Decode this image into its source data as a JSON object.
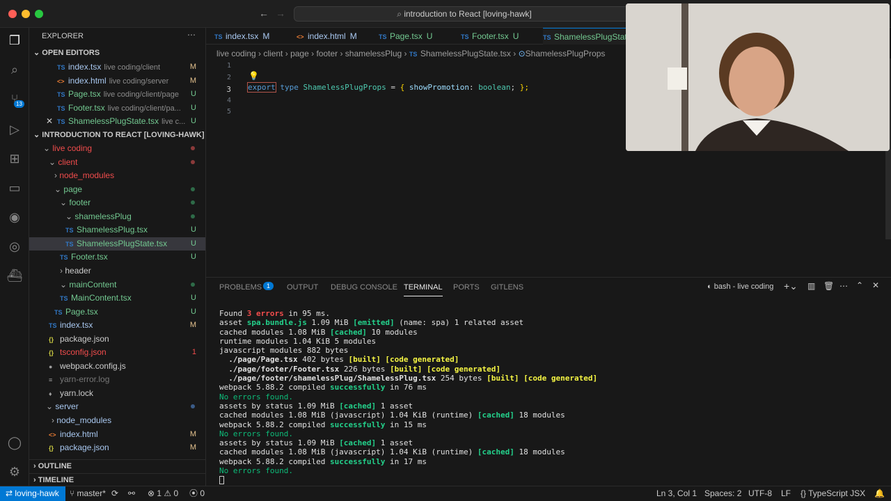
{
  "window": {
    "command_center": "introduction to React [loving-hawk]"
  },
  "sidebar": {
    "title": "EXPLORER",
    "open_editors_title": "OPEN EDITORS",
    "open_editors": [
      {
        "icon": "TS",
        "name": "index.tsx",
        "desc": "live coding/client",
        "status": "M"
      },
      {
        "icon": "<>",
        "name": "index.html",
        "desc": "live coding/server",
        "status": "M"
      },
      {
        "icon": "TS",
        "name": "Page.tsx",
        "desc": "live coding/client/page",
        "status": "U"
      },
      {
        "icon": "TS",
        "name": "Footer.tsx",
        "desc": "live coding/client/pa...",
        "status": "U"
      },
      {
        "icon": "TS",
        "name": "ShamelessPlugState.tsx",
        "desc": "live c...",
        "status": "U"
      }
    ],
    "project_title": "INTRODUCTION TO REACT [LOVING-HAWK]",
    "tree": [
      {
        "name": "live coding",
        "type": "folder-open"
      },
      {
        "name": "client",
        "type": "folder-open"
      },
      {
        "name": "node_modules",
        "type": "folder"
      },
      {
        "name": "page",
        "type": "folder-open"
      },
      {
        "name": "footer",
        "type": "folder-open"
      },
      {
        "name": "shamelessPlug",
        "type": "folder-open"
      },
      {
        "icon": "TS",
        "name": "ShamelessPlug.tsx",
        "status": "U"
      },
      {
        "icon": "TS",
        "name": "ShamelessPlugState.tsx",
        "status": "U"
      },
      {
        "icon": "TS",
        "name": "Footer.tsx",
        "status": "U"
      },
      {
        "name": "header",
        "type": "folder"
      },
      {
        "name": "mainContent",
        "type": "folder-open"
      },
      {
        "icon": "TS",
        "name": "MainContent.tsx",
        "status": "U"
      },
      {
        "icon": "TS",
        "name": "Page.tsx",
        "status": "U"
      },
      {
        "icon": "TS",
        "name": "index.tsx",
        "status": "M"
      },
      {
        "icon": "{}",
        "name": "package.json"
      },
      {
        "icon": "{}",
        "name": "tsconfig.json",
        "status": "1"
      },
      {
        "icon": "●",
        "name": "webpack.config.js"
      },
      {
        "icon": "≡",
        "name": "yarn-error.log"
      },
      {
        "icon": "♦",
        "name": "yarn.lock"
      },
      {
        "name": "server",
        "type": "folder-open"
      },
      {
        "name": "node_modules",
        "type": "folder"
      },
      {
        "icon": "<>",
        "name": "index.html",
        "status": "M"
      },
      {
        "icon": "{}",
        "name": "package.json",
        "status": "M"
      }
    ],
    "outline": "OUTLINE",
    "timeline": "TIMELINE"
  },
  "tabs": [
    {
      "icon": "TS",
      "label": "index.tsx",
      "status": "M"
    },
    {
      "icon": "<>",
      "label": "index.html",
      "status": "M"
    },
    {
      "icon": "TS",
      "label": "Page.tsx",
      "status": "U"
    },
    {
      "icon": "TS",
      "label": "Footer.tsx",
      "status": "U"
    },
    {
      "icon": "TS",
      "label": "ShamelessPlugStat"
    }
  ],
  "breadcrumb": [
    "live coding",
    "client",
    "page",
    "footer",
    "shamelessPlug",
    "ShamelessPlugState.tsx",
    "ShamelessPlugProps"
  ],
  "editor": {
    "line_numbers": [
      "1",
      "2",
      "3",
      "4",
      "5"
    ],
    "code": {
      "kw1": "export",
      "kw2": "type",
      "name": "ShamelessPlugProps",
      "eq": "=",
      "lb": "{",
      "prop": "showPromotion",
      "colon": ":",
      "type": "boolean",
      "semi": ";",
      "rb": "};"
    }
  },
  "panel": {
    "tabs": [
      "PROBLEMS",
      "OUTPUT",
      "DEBUG CONSOLE",
      "TERMINAL",
      "PORTS",
      "GITLENS"
    ],
    "problems_count": "1",
    "terminal_name": "bash - live coding",
    "lines": [
      [
        {
          "t": "Found "
        },
        {
          "t": "3 errors",
          "c": "red"
        },
        {
          "t": " in 95 ms."
        }
      ],
      [
        {
          "t": "asset "
        },
        {
          "t": "spa.bundle.js",
          "c": "grn"
        },
        {
          "t": " 1.09 MiB "
        },
        {
          "t": "[emitted]",
          "c": "grn"
        },
        {
          "t": " (name: spa) 1 related asset"
        }
      ],
      [
        {
          "t": "cached modules 1.08 MiB "
        },
        {
          "t": "[cached]",
          "c": "grn"
        },
        {
          "t": " 10 modules"
        }
      ],
      [
        {
          "t": "runtime modules 1.04 KiB 5 modules"
        }
      ],
      [
        {
          "t": "javascript modules 882 bytes"
        }
      ],
      [
        {
          "t": "  "
        },
        {
          "t": "./page/Page.tsx",
          "c": "bold"
        },
        {
          "t": " 402 bytes "
        },
        {
          "t": "[built] [code generated]",
          "c": "yel"
        }
      ],
      [
        {
          "t": "  "
        },
        {
          "t": "./page/footer/Footer.tsx",
          "c": "bold"
        },
        {
          "t": " 226 bytes "
        },
        {
          "t": "[built] [code generated]",
          "c": "yel"
        }
      ],
      [
        {
          "t": "  "
        },
        {
          "t": "./page/footer/shamelessPlug/ShamelessPlug.tsx",
          "c": "bold"
        },
        {
          "t": " 254 bytes "
        },
        {
          "t": "[built] [code generated]",
          "c": "yel"
        }
      ],
      [
        {
          "t": "webpack 5.88.2 compiled "
        },
        {
          "t": "successfully",
          "c": "grn"
        },
        {
          "t": " in 76 ms"
        }
      ],
      [
        {
          "t": "No errors found.",
          "c": "ok"
        }
      ],
      [
        {
          "t": "assets by status 1.09 MiB "
        },
        {
          "t": "[cached]",
          "c": "grn"
        },
        {
          "t": " 1 asset"
        }
      ],
      [
        {
          "t": "cached modules 1.08 MiB (javascript) 1.04 KiB (runtime) "
        },
        {
          "t": "[cached]",
          "c": "grn"
        },
        {
          "t": " 18 modules"
        }
      ],
      [
        {
          "t": "webpack 5.88.2 compiled "
        },
        {
          "t": "successfully",
          "c": "grn"
        },
        {
          "t": " in 15 ms"
        }
      ],
      [
        {
          "t": "No errors found.",
          "c": "ok"
        }
      ],
      [
        {
          "t": "assets by status 1.09 MiB "
        },
        {
          "t": "[cached]",
          "c": "grn"
        },
        {
          "t": " 1 asset"
        }
      ],
      [
        {
          "t": "cached modules 1.08 MiB (javascript) 1.04 KiB (runtime) "
        },
        {
          "t": "[cached]",
          "c": "grn"
        },
        {
          "t": " 18 modules"
        }
      ],
      [
        {
          "t": "webpack 5.88.2 compiled "
        },
        {
          "t": "successfully",
          "c": "grn"
        },
        {
          "t": " in 17 ms"
        }
      ],
      [
        {
          "t": "No errors found.",
          "c": "ok"
        }
      ]
    ]
  },
  "status": {
    "remote": "loving-hawk",
    "branch": "master*",
    "errors": "1",
    "warnings": "0",
    "ports": "0",
    "position": "Ln 3, Col 1",
    "spaces": "Spaces: 2",
    "encoding": "UTF-8",
    "eol": "LF",
    "language": "TypeScript JSX"
  },
  "colors": {
    "accent": "#0078d4",
    "ts": "#3178c6",
    "untracked": "#73c991",
    "modified": "#e2c08d",
    "error": "#f14c4c"
  }
}
